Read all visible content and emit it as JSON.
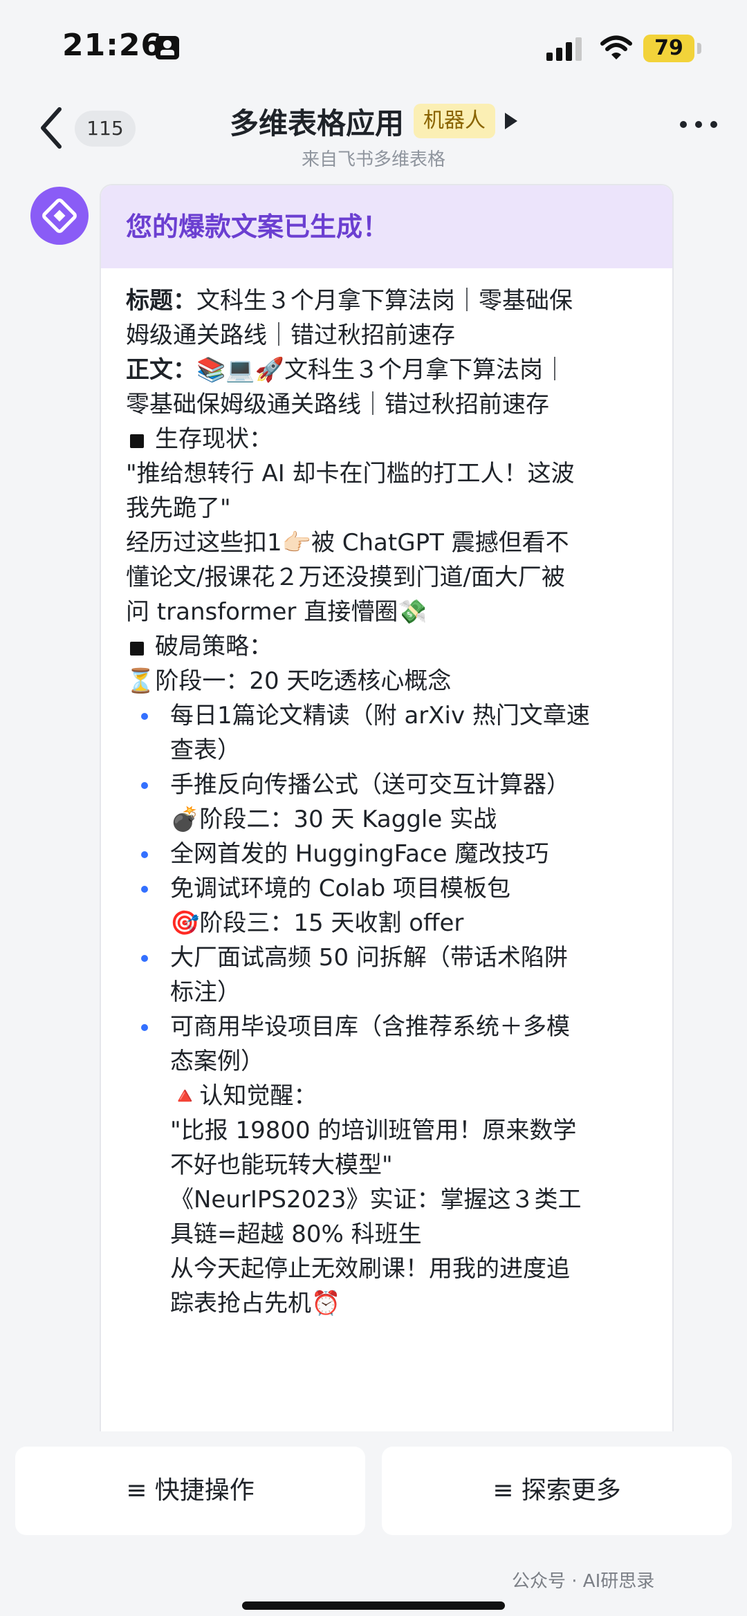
{
  "status_bar": {
    "time": "21:26",
    "battery": "79"
  },
  "nav": {
    "unread_count": "115",
    "title": "多维表格应用",
    "badge": "机器人",
    "subtitle": "来自飞书多维表格"
  },
  "message": {
    "header": "您的爆款文案已生成！",
    "lines": [
      {
        "style": "label",
        "label": "标题：",
        "text": "文科生３个月拿下算法岗｜零基础保"
      },
      {
        "style": "plain",
        "text": "姆级通关路线｜错过秋招前速存"
      },
      {
        "style": "label",
        "label": "正文：",
        "text": "📚💻🚀文科生３个月拿下算法岗｜"
      },
      {
        "style": "plain",
        "text": "零基础保姆级通关路线｜错过秋招前速存"
      },
      {
        "style": "square",
        "text": "生存现状："
      },
      {
        "style": "plain",
        "text": "\"推给想转行 AI 却卡在门槛的打工人！这波"
      },
      {
        "style": "plain",
        "text": "我先跪了\""
      },
      {
        "style": "plain",
        "text": "经历过这些扣1👉🏻被 ChatGPT 震撼但看不"
      },
      {
        "style": "plain",
        "text": "懂论文/报课花２万还没摸到门道/面大厂被"
      },
      {
        "style": "plain",
        "text": "问 transformer 直接懵圈💸"
      },
      {
        "style": "square",
        "text": "破局策略："
      },
      {
        "style": "plain",
        "text": "⏳阶段一：20 天吃透核心概念"
      },
      {
        "style": "bullet",
        "text": "每日1篇论文精读（附 arXiv 热门文章速"
      },
      {
        "style": "indent",
        "text": "查表）"
      },
      {
        "style": "bullet",
        "text": "手推反向传播公式（送可交互计算器）"
      },
      {
        "style": "indent",
        "text": "💣阶段二：30 天 Kaggle 实战"
      },
      {
        "style": "bullet",
        "text": "全网首发的 HuggingFace 魔改技巧"
      },
      {
        "style": "bullet",
        "text": "免调试环境的 Colab 项目模板包"
      },
      {
        "style": "indent",
        "text": "🎯阶段三：15 天收割 offer"
      },
      {
        "style": "bullet",
        "text": "大厂面试高频 50 问拆解（带话术陷阱"
      },
      {
        "style": "indent",
        "text": "标注）"
      },
      {
        "style": "bullet",
        "text": "可商用毕设项目库（含推荐系统＋多模"
      },
      {
        "style": "indent",
        "text": "态案例）"
      },
      {
        "style": "indent",
        "text": "🔺认知觉醒："
      },
      {
        "style": "indent",
        "text": "\"比报 19800 的培训班管用！原来数学"
      },
      {
        "style": "indent",
        "text": "不好也能玩转大模型\""
      },
      {
        "style": "indent",
        "text": "《NeurIPS2023》实证：掌握这３类工"
      },
      {
        "style": "indent",
        "text": "具链=超越 80% 科班生"
      },
      {
        "style": "indent",
        "text": "从今天起停止无效刷课！用我的进度追"
      },
      {
        "style": "indent",
        "text": "踪表抢占先机⏰"
      }
    ]
  },
  "bottom": {
    "quick_actions": "≡ 快捷操作",
    "explore_more": "≡ 探索更多",
    "watermark": "公众号 · AI研思录"
  }
}
